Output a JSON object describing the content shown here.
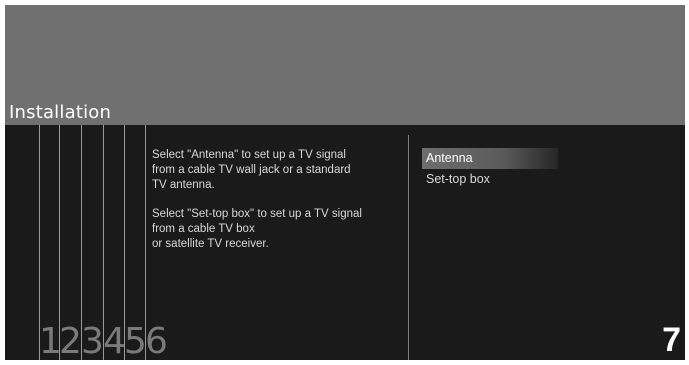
{
  "header": {
    "title": "Installation"
  },
  "steps": [
    "1",
    "2",
    "3",
    "4",
    "5",
    "6"
  ],
  "description": {
    "para1": "Select \"Antenna\" to set up a TV signal\nfrom a cable TV wall jack or a standard\nTV antenna.",
    "para2": "Select \"Set-top box\" to set up a TV signal\nfrom a cable TV box\nor satellite TV receiver."
  },
  "options": [
    {
      "label": "Antenna",
      "selected": true
    },
    {
      "label": "Set-top box",
      "selected": false
    }
  ],
  "current_step": "7",
  "colors": {
    "header_bg": "#707070",
    "panel_bg": "#1a1a1a",
    "highlight": "#6e6e6e"
  }
}
